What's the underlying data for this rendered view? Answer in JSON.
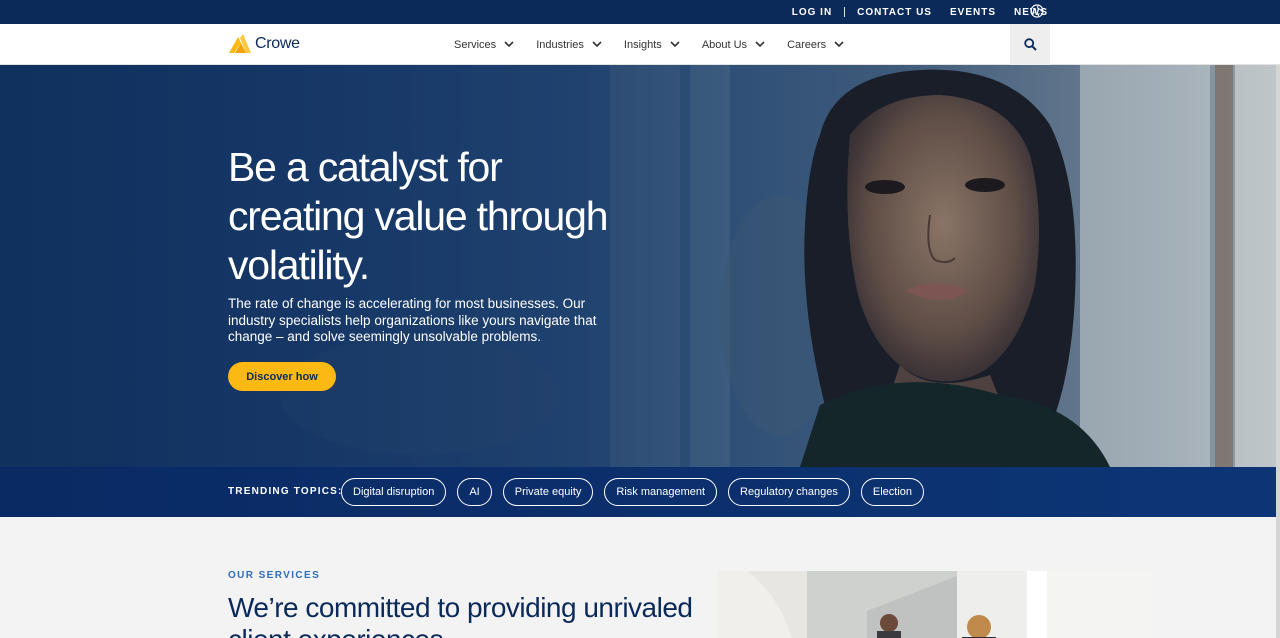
{
  "utility": {
    "login": "LOG IN",
    "contact": "CONTACT US",
    "events": "EVENTS",
    "news": "NEWS"
  },
  "nav": {
    "logo_text": "Crowe",
    "items": [
      {
        "label": "Services"
      },
      {
        "label": "Industries"
      },
      {
        "label": "Insights"
      },
      {
        "label": "About Us"
      },
      {
        "label": "Careers"
      }
    ]
  },
  "hero": {
    "title": "Be a catalyst for creating value through volatility.",
    "description": "The rate of change is accelerating for most businesses. Our industry specialists help organizations like yours navigate that change – and solve seemingly unsolvable problems.",
    "cta": "Discover how"
  },
  "trending": {
    "label": "TRENDING TOPICS:",
    "topics": [
      {
        "label": "Digital disruption"
      },
      {
        "label": "AI"
      },
      {
        "label": "Private equity"
      },
      {
        "label": "Risk management"
      },
      {
        "label": "Regulatory changes"
      },
      {
        "label": "Election"
      }
    ]
  },
  "services": {
    "label": "OUR SERVICES",
    "title": "We’re committed to providing unrivaled client experiences"
  },
  "icons": {
    "globe": "globe-icon",
    "search": "search-icon",
    "chevron": "chevron-down-icon",
    "logo": "crowe-logo-icon"
  },
  "colors": {
    "brand_navy": "#0b2a5a",
    "accent_gold": "#fdb913",
    "label_blue": "#2f6db5"
  }
}
